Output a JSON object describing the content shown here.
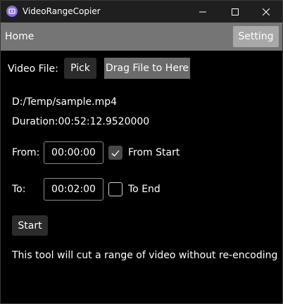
{
  "window": {
    "title": "VideoRangeCopier",
    "icon": "app-icon",
    "controls": [
      "minimize-icon",
      "maximize-icon",
      "close-icon"
    ]
  },
  "nav": {
    "home_label": "Home",
    "setting_label": "Setting"
  },
  "file": {
    "label": "Video File:",
    "pick_label": "Pick",
    "drag_label": "Drag File to Here",
    "path": "D:/Temp/sample.mp4",
    "duration": "Duration:00:52:12.9520000"
  },
  "range": {
    "from_label": "From:",
    "from_value": "00:00:00",
    "from_start_label": "From Start",
    "from_start_checked": true,
    "to_label": "To:",
    "to_value": "00:02:00",
    "to_end_label": "To End",
    "to_end_checked": false
  },
  "actions": {
    "start_label": "Start"
  },
  "info": {
    "description": "This tool will cut a range of video without re-encoding"
  },
  "colors": {
    "background": "#000000",
    "navbar": "#757575",
    "setting_button": "#a8a8a8",
    "drag_button": "#6b6b6b"
  }
}
